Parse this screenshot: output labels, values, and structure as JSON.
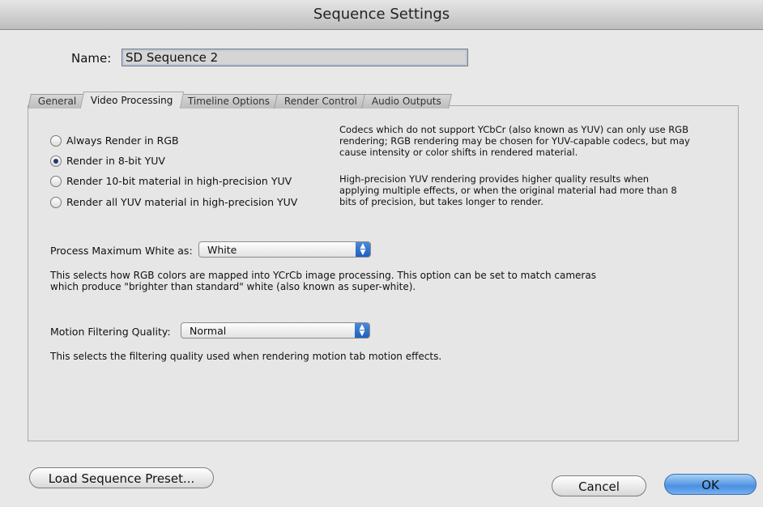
{
  "window": {
    "title": "Sequence Settings"
  },
  "name_field": {
    "label": "Name:",
    "value": "SD Sequence 2"
  },
  "tabs": [
    {
      "label": "General",
      "active": false
    },
    {
      "label": "Video Processing",
      "active": true
    },
    {
      "label": "Timeline Options",
      "active": false
    },
    {
      "label": "Render Control",
      "active": false
    },
    {
      "label": "Audio Outputs",
      "active": false
    }
  ],
  "render_options": [
    {
      "label": "Always Render in RGB",
      "checked": false
    },
    {
      "label": "Render in 8-bit YUV",
      "checked": true
    },
    {
      "label": "Render 10-bit material in high-precision YUV",
      "checked": false
    },
    {
      "label": "Render all YUV material in high-precision YUV",
      "checked": false
    }
  ],
  "info_text": {
    "codecs": [
      "Codecs which do not support YCbCr (also known as YUV) can only use RGB",
      "rendering; RGB rendering may be chosen for YUV-capable codecs, but may",
      "cause intensity or color shifts in rendered material."
    ],
    "high_precision": [
      "High-precision YUV rendering provides higher quality results when",
      "applying multiple effects, or when the original material had more than 8",
      "bits of precision, but takes longer to render."
    ]
  },
  "max_white": {
    "label": "Process Maximum White as:",
    "value": "White",
    "description": [
      "This selects how RGB colors are mapped into YCrCb image processing. This option can be set to match cameras",
      "which produce \"brighter than standard\" white (also known as super-white)."
    ]
  },
  "motion_filtering": {
    "label": "Motion Filtering Quality:",
    "value": "Normal",
    "description": "This selects the filtering quality used when rendering motion tab motion effects."
  },
  "buttons": {
    "load_preset": "Load Sequence Preset...",
    "cancel": "Cancel",
    "ok": "OK"
  },
  "colors": {
    "accent": "#4a90e2",
    "selected_radio": "#1a3d6e"
  }
}
